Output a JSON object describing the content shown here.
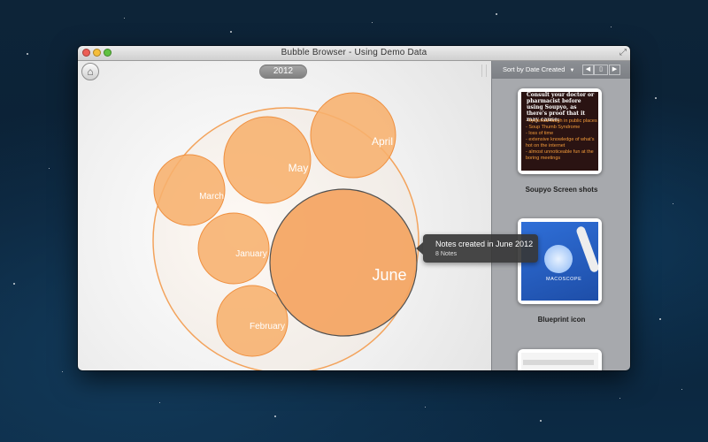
{
  "window": {
    "title": "Bubble Browser - Using Demo Data",
    "fullscreen_icon": "fullscreen-icon"
  },
  "main": {
    "home_icon": "house-icon",
    "year": "2012",
    "bubbles": [
      {
        "label": "April",
        "color": "#f7b06d"
      },
      {
        "label": "May",
        "color": "#f7b06d"
      },
      {
        "label": "March",
        "color": "#f7b06d"
      },
      {
        "label": "January",
        "color": "#f7b06d"
      },
      {
        "label": "February",
        "color": "#f7b06d"
      },
      {
        "label": "June",
        "color": "#f4a461"
      }
    ],
    "tooltip": {
      "title": "Notes created in June 2012",
      "subtitle": "8 Notes"
    }
  },
  "sidebar": {
    "sort_label": "Sort by Date Created",
    "sort_arrow": "▼",
    "nav_prev": "◀",
    "nav_next": "▶",
    "items": [
      {
        "label": "Soupyo Screen shots",
        "preview_heading": "Consult your doctor or pharmacist before using Soupyo, as there's proof that it may cause:",
        "preview_list": [
          "- hysterical laugh in public places",
          "- Soup Thumb Syndrome",
          "- loss of time",
          "- extensive knowledge of what's hot on the internet",
          "- almost unnoticeable fun at the boring meetings"
        ]
      },
      {
        "label": "Blueprint icon",
        "preview_text": "MACOSCOPE"
      },
      {
        "label": ""
      }
    ]
  },
  "colors": {
    "bubble_fill": "#f7b06d",
    "bubble_stroke": "#ef9040",
    "outer_ring": "#f3a35c",
    "tooltip_bg": "#373737",
    "sidebar_bg": "#a7a9ad"
  }
}
